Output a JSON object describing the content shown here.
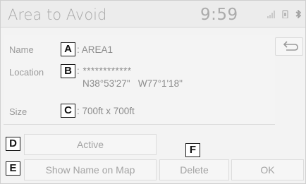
{
  "header": {
    "title": "Area to Avoid",
    "clock": "9:59"
  },
  "fields": {
    "name": {
      "label": "Name",
      "callout": "A",
      "value": ": AREA1"
    },
    "location": {
      "label": "Location",
      "callout": "B",
      "masked": ": ************",
      "coords": "N38°53'27\"   W77°1'18\""
    },
    "size": {
      "label": "Size",
      "callout": "C",
      "value": ": 700ft x 700ft"
    }
  },
  "buttons": {
    "active": {
      "label": "Active",
      "callout": "D"
    },
    "show_name": {
      "label": "Show Name on Map",
      "callout": "E"
    },
    "delete": {
      "label": "Delete",
      "callout": "F"
    },
    "ok": {
      "label": "OK"
    }
  },
  "icons": {
    "back": "return-arrow-icon",
    "signal": "signal-bars-icon",
    "phone": "phone-icon",
    "bluetooth": "bluetooth-icon"
  }
}
